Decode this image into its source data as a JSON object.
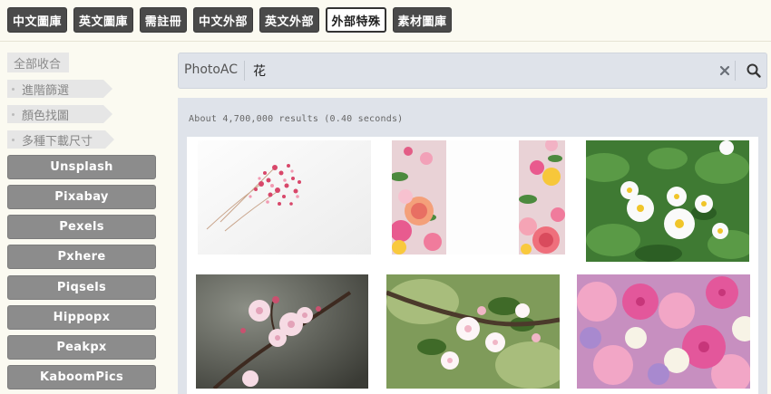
{
  "top_tabs": [
    {
      "label": "中文圖庫",
      "active": false
    },
    {
      "label": "英文圖庫",
      "active": false
    },
    {
      "label": "需註冊",
      "active": false
    },
    {
      "label": "中文外部",
      "active": false
    },
    {
      "label": "英文外部",
      "active": false
    },
    {
      "label": "外部特殊",
      "active": true
    },
    {
      "label": "素材圖庫",
      "active": false
    }
  ],
  "sidebar": {
    "collapse_all": "全部收合",
    "filters": [
      "進階篩選",
      "顏色找圖",
      "多種下載尺寸"
    ],
    "sources": [
      "Unsplash",
      "Pixabay",
      "Pexels",
      "Pxhere",
      "Piqsels",
      "Hippopx",
      "Peakpx",
      "KaboomPics"
    ]
  },
  "search": {
    "provider": "PhotoAC",
    "query": "花"
  },
  "results": {
    "stats": "About 4,700,000 results (0.40 seconds)",
    "images": [
      "baby-breath-pink-flowers",
      "rose-flower-frame",
      "white-flowers-green-leaves",
      "cherry-blossom-dark",
      "apple-blossom-green",
      "gerbera-rose-bouquet"
    ]
  },
  "colors": {
    "tab_bg": "#4a4a4a",
    "source_btn_bg": "#8c8c8c",
    "panel_bg": "#dfe3ea",
    "page_bg": "#fbfaf1"
  }
}
